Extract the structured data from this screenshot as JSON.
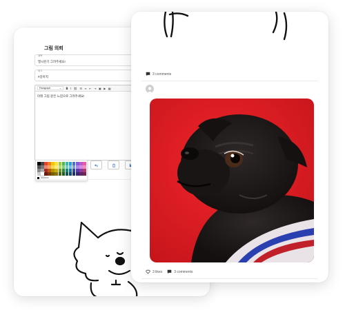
{
  "form": {
    "title": "그림 의뢰",
    "title_field": {
      "label": "제목",
      "value": "멸시된기 그려주세요!"
    },
    "tag_field": {
      "label": "태그",
      "value": "#강아지"
    },
    "editor": {
      "paragraph_select": "Paragraph",
      "body_text": "아래 그림 같은 느낌으로 그려주세요!"
    },
    "palette": {
      "hex_value": "#000000",
      "colors": [
        "#000000",
        "#444444",
        "#e8412e",
        "#ef7d1e",
        "#f5c400",
        "#f7e23b",
        "#9acc3a",
        "#4cb848",
        "#2bbfa3",
        "#2d9ad8",
        "#4a6bd8",
        "#7f5bd6",
        "#c05ad4",
        "#e85c9f",
        "#555555",
        "#777777",
        "#f08070",
        "#f5a65a",
        "#f8d64a",
        "#f9ec76",
        "#b8dd6a",
        "#7fcf77",
        "#6dd4c0",
        "#6dbde8",
        "#7f99e6",
        "#a78ce3",
        "#d68ae3",
        "#f08fbf",
        "#888888",
        "#aaaaaa",
        "#a82a1c",
        "#b85a12",
        "#b89200",
        "#c2ae1b",
        "#6c9a22",
        "#2f8a30",
        "#178a76",
        "#1c6fa3",
        "#2d48a8",
        "#5a3aa6",
        "#8d3aa0",
        "#b03a72",
        "#cccccc",
        "#ffffff",
        "#6e1a12",
        "#7a3b0c",
        "#7a6000",
        "#837512",
        "#476616",
        "#1f5c20",
        "#0f5c4e",
        "#124a6d",
        "#1e306f",
        "#3b266e",
        "#5e266a",
        "#74264c"
      ]
    }
  },
  "feed": {
    "post1_comments": "3 comments",
    "post2_likes": "3 likes",
    "post2_comments": "3 comments"
  },
  "colors": {
    "photo_background": "#e31e24",
    "dog_fur": "#1e1a1a",
    "accent_blue": "#2a6fd0"
  }
}
